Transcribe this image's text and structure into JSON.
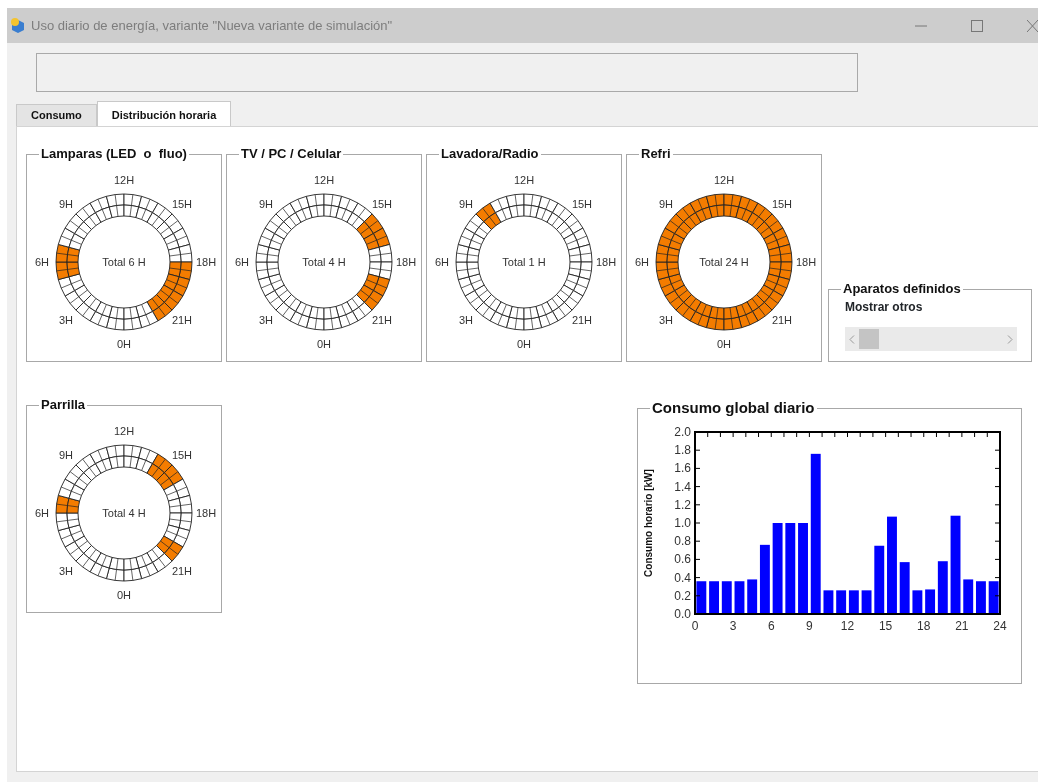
{
  "window": {
    "title": "Uso diario de energía, variante \"Nueva variante de simulación\""
  },
  "tabs": [
    {
      "label": "Consumo",
      "selected": false
    },
    {
      "label": "Distribución horaria",
      "selected": true
    }
  ],
  "clocks": [
    {
      "title": "Lamparas (LED  o  fluo)",
      "total": "Total 6 H",
      "hour_labels": [
        "0H",
        "3H",
        "6H",
        "9H",
        "12H",
        "15H",
        "18H",
        "21H"
      ],
      "hours_on": [
        false,
        false,
        false,
        false,
        false,
        true,
        true,
        false,
        false,
        false,
        false,
        false,
        false,
        false,
        false,
        false,
        false,
        false,
        true,
        true,
        true,
        true,
        false,
        false
      ]
    },
    {
      "title": "TV / PC / Celular",
      "total": "Total 4 H",
      "hour_labels": [
        "0H",
        "3H",
        "6H",
        "9H",
        "12H",
        "15H",
        "18H",
        "21H"
      ],
      "hours_on": [
        false,
        false,
        false,
        false,
        false,
        false,
        false,
        false,
        false,
        false,
        false,
        false,
        false,
        false,
        false,
        true,
        true,
        false,
        false,
        true,
        true,
        false,
        false,
        false
      ]
    },
    {
      "title": "Lavadora/Radio",
      "total": "Total 1 H",
      "hour_labels": [
        "0H",
        "3H",
        "6H",
        "9H",
        "12H",
        "15H",
        "18H",
        "21H"
      ],
      "hours_on": [
        false,
        false,
        false,
        false,
        false,
        false,
        false,
        false,
        false,
        true,
        false,
        false,
        false,
        false,
        false,
        false,
        false,
        false,
        false,
        false,
        false,
        false,
        false,
        false
      ]
    },
    {
      "title": "Refri",
      "total": "Total 24 H",
      "hour_labels": [
        "0H",
        "3H",
        "6H",
        "9H",
        "12H",
        "15H",
        "18H",
        "21H"
      ],
      "hours_on": [
        true,
        true,
        true,
        true,
        true,
        true,
        true,
        true,
        true,
        true,
        true,
        true,
        true,
        true,
        true,
        true,
        true,
        true,
        true,
        true,
        true,
        true,
        true,
        true
      ]
    },
    {
      "title": "Parrilla",
      "total": "Total 4 H",
      "hour_labels": [
        "0H",
        "3H",
        "6H",
        "9H",
        "12H",
        "15H",
        "18H",
        "21H"
      ],
      "hours_on": [
        false,
        false,
        false,
        false,
        false,
        false,
        true,
        false,
        false,
        false,
        false,
        false,
        false,
        false,
        true,
        true,
        false,
        false,
        false,
        false,
        true,
        false,
        false,
        false
      ]
    }
  ],
  "devices_panel": {
    "title": "Aparatos definidos",
    "label": "Mostrar otros"
  },
  "chart_panel": {
    "title": "Consumo global diario",
    "chart_data": {
      "type": "bar",
      "ylabel": "Consumo horario [kW]",
      "x": [
        0.5,
        1.5,
        2.5,
        3.5,
        4.5,
        5.5,
        6.5,
        7.5,
        8.5,
        9.5,
        10.5,
        11.5,
        12.5,
        13.5,
        14.5,
        15.5,
        16.5,
        17.5,
        18.5,
        19.5,
        20.5,
        21.5,
        22.5,
        23.5
      ],
      "values": [
        0.36,
        0.36,
        0.36,
        0.36,
        0.38,
        0.76,
        1.0,
        1.0,
        1.0,
        1.76,
        0.26,
        0.26,
        0.26,
        0.26,
        0.75,
        1.07,
        0.57,
        0.26,
        0.27,
        0.58,
        1.08,
        0.38,
        0.36,
        0.36
      ],
      "xlim": [
        0,
        24
      ],
      "ylim": [
        0,
        2
      ],
      "xticks": [
        0,
        3,
        6,
        9,
        12,
        15,
        18,
        21,
        24
      ],
      "yticks": [
        {
          "value": 0,
          "label": "0.0"
        },
        {
          "value": 0.2,
          "label": "0.2"
        },
        {
          "value": 0.4,
          "label": "0.4"
        },
        {
          "value": 0.6,
          "label": "0.6"
        },
        {
          "value": 0.8,
          "label": "0.8"
        },
        {
          "value": 1.0,
          "label": "1.0"
        },
        {
          "value": 1.2,
          "label": "1.2"
        },
        {
          "value": 1.4,
          "label": "1.4"
        },
        {
          "value": 1.6,
          "label": "1.6"
        },
        {
          "value": 1.8,
          "label": "1.8"
        },
        {
          "value": 2.0,
          "label": "2.0"
        }
      ]
    }
  }
}
